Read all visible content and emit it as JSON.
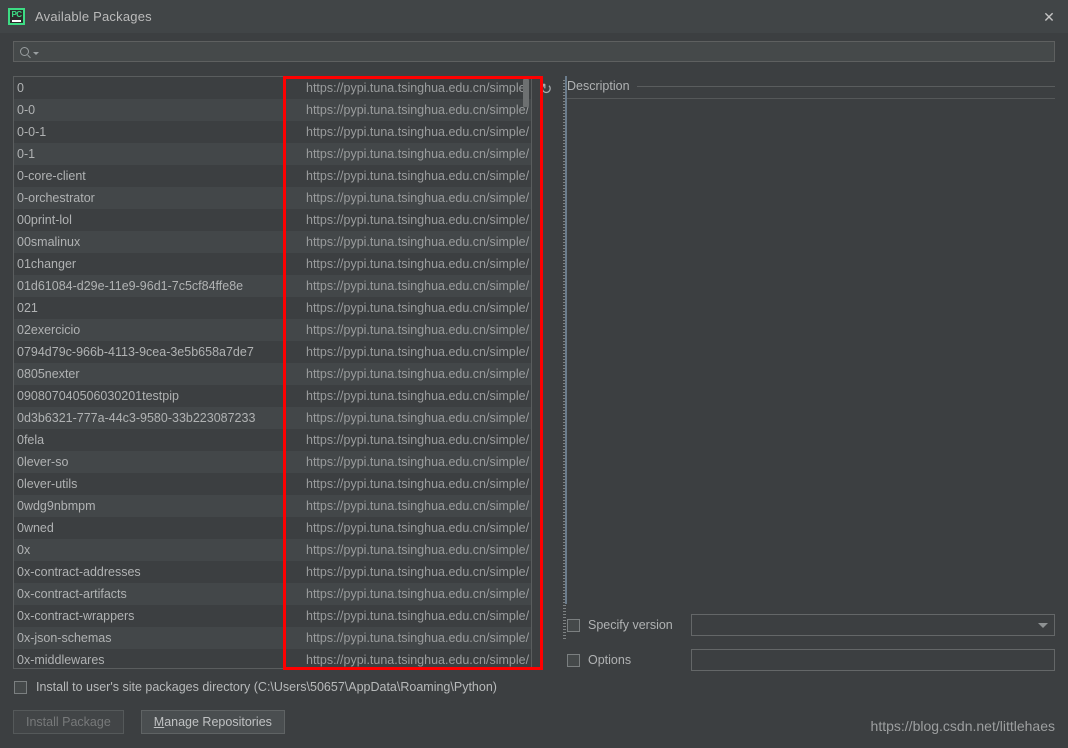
{
  "window": {
    "title": "Available Packages",
    "app_icon": "pycharm-icon",
    "app_icon_text": "PC",
    "close_icon": "✕",
    "accent_red": "#fe0000",
    "accent_green": "#3ddc84",
    "background": "#3c3f41"
  },
  "search": {
    "value": "",
    "placeholder": "",
    "icon": "search-icon",
    "dropdown_icon": "chevron-down-icon"
  },
  "packages": {
    "refresh_icon": "↻",
    "repository_url": "https://pypi.tuna.tsinghua.edu.cn/simple/",
    "rows": [
      {
        "name": "0",
        "url": "https://pypi.tuna.tsinghua.edu.cn/simple/"
      },
      {
        "name": "0-0",
        "url": "https://pypi.tuna.tsinghua.edu.cn/simple/"
      },
      {
        "name": "0-0-1",
        "url": "https://pypi.tuna.tsinghua.edu.cn/simple/"
      },
      {
        "name": "0-1",
        "url": "https://pypi.tuna.tsinghua.edu.cn/simple/"
      },
      {
        "name": "0-core-client",
        "url": "https://pypi.tuna.tsinghua.edu.cn/simple/"
      },
      {
        "name": "0-orchestrator",
        "url": "https://pypi.tuna.tsinghua.edu.cn/simple/"
      },
      {
        "name": "00print-lol",
        "url": "https://pypi.tuna.tsinghua.edu.cn/simple/"
      },
      {
        "name": "00smalinux",
        "url": "https://pypi.tuna.tsinghua.edu.cn/simple/"
      },
      {
        "name": "01changer",
        "url": "https://pypi.tuna.tsinghua.edu.cn/simple/"
      },
      {
        "name": "01d61084-d29e-11e9-96d1-7c5cf84ffe8e",
        "url": "https://pypi.tuna.tsinghua.edu.cn/simple/"
      },
      {
        "name": "021",
        "url": "https://pypi.tuna.tsinghua.edu.cn/simple/"
      },
      {
        "name": "02exercicio",
        "url": "https://pypi.tuna.tsinghua.edu.cn/simple/"
      },
      {
        "name": "0794d79c-966b-4113-9cea-3e5b658a7de7",
        "url": "https://pypi.tuna.tsinghua.edu.cn/simple/"
      },
      {
        "name": "0805nexter",
        "url": "https://pypi.tuna.tsinghua.edu.cn/simple/"
      },
      {
        "name": "090807040506030201testpip",
        "url": "https://pypi.tuna.tsinghua.edu.cn/simple/"
      },
      {
        "name": "0d3b6321-777a-44c3-9580-33b223087233",
        "url": "https://pypi.tuna.tsinghua.edu.cn/simple/"
      },
      {
        "name": "0fela",
        "url": "https://pypi.tuna.tsinghua.edu.cn/simple/"
      },
      {
        "name": "0lever-so",
        "url": "https://pypi.tuna.tsinghua.edu.cn/simple/"
      },
      {
        "name": "0lever-utils",
        "url": "https://pypi.tuna.tsinghua.edu.cn/simple/"
      },
      {
        "name": "0wdg9nbmpm",
        "url": "https://pypi.tuna.tsinghua.edu.cn/simple/"
      },
      {
        "name": "0wned",
        "url": "https://pypi.tuna.tsinghua.edu.cn/simple/"
      },
      {
        "name": "0x",
        "url": "https://pypi.tuna.tsinghua.edu.cn/simple/"
      },
      {
        "name": "0x-contract-addresses",
        "url": "https://pypi.tuna.tsinghua.edu.cn/simple/"
      },
      {
        "name": "0x-contract-artifacts",
        "url": "https://pypi.tuna.tsinghua.edu.cn/simple/"
      },
      {
        "name": "0x-contract-wrappers",
        "url": "https://pypi.tuna.tsinghua.edu.cn/simple/"
      },
      {
        "name": "0x-json-schemas",
        "url": "https://pypi.tuna.tsinghua.edu.cn/simple/"
      },
      {
        "name": "0x-middlewares",
        "url": "https://pypi.tuna.tsinghua.edu.cn/simple/"
      }
    ]
  },
  "description": {
    "header": "Description",
    "body": ""
  },
  "options_panel": {
    "specify_version": {
      "label": "Specify version",
      "checked": false,
      "value": "",
      "dropdown_icon": "chevron-down-icon"
    },
    "options": {
      "label": "Options",
      "checked": false,
      "value": "",
      "placeholder": ""
    }
  },
  "footer": {
    "install_to_user_site": {
      "label": "Install to user's site packages directory (C:\\Users\\50657\\AppData\\Roaming\\Python)",
      "checked": false
    },
    "install_package_button": "Install Package",
    "install_package_enabled": false,
    "manage_repositories_button": "Manage Repositories",
    "manage_repositories_mnemonic": "M",
    "manage_repositories_rest": "anage Repositories",
    "watermark": "https://blog.csdn.net/littlehaes"
  }
}
